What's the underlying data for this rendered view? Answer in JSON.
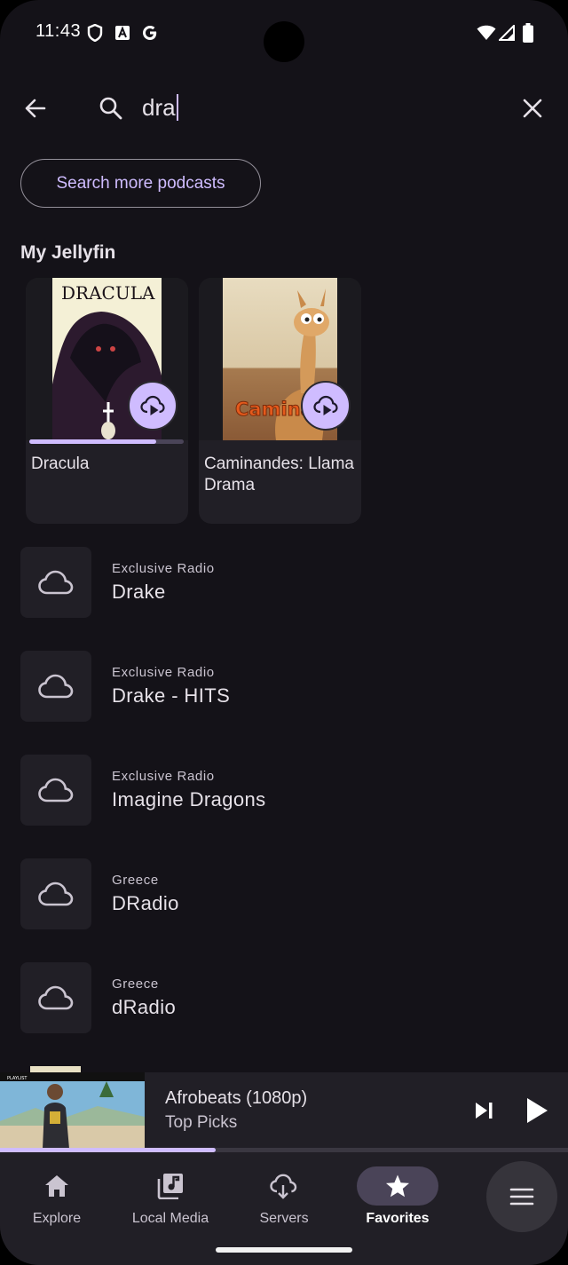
{
  "status_bar": {
    "time": "11:43",
    "left_icons": [
      "shield-icon",
      "a-badge-icon",
      "g-logo-icon"
    ],
    "right_icons": [
      "wifi-icon",
      "signal-icon",
      "battery-icon"
    ]
  },
  "search": {
    "query": "dra",
    "back_icon": "arrow-left-icon",
    "search_icon": "search-icon",
    "clear_icon": "close-icon"
  },
  "chip": {
    "label": "Search more podcasts"
  },
  "section": {
    "title": "My Jellyfin"
  },
  "cards": [
    {
      "title": "Dracula",
      "art_text": "DRACULA",
      "progress": 0.82,
      "icon": "cloud-play-icon"
    },
    {
      "title": "Caminandes: Llama Drama",
      "art_text": "Caminan",
      "icon": "cloud-play-icon"
    }
  ],
  "list": [
    {
      "subtitle": "Exclusive Radio",
      "title": "Drake",
      "icon": "cloud-icon"
    },
    {
      "subtitle": "Exclusive Radio",
      "title": "Drake - HITS",
      "icon": "cloud-icon"
    },
    {
      "subtitle": "Exclusive Radio",
      "title": "Imagine Dragons",
      "icon": "cloud-icon"
    },
    {
      "subtitle": "Greece",
      "title": "DRadio",
      "icon": "cloud-icon"
    },
    {
      "subtitle": "Greece",
      "title": "dRadio",
      "icon": "cloud-icon"
    }
  ],
  "mini_player": {
    "title": "Afrobeats (1080p)",
    "subtitle": "Top Picks",
    "thumb_text": "PLAYLIST",
    "progress": 0.38,
    "icons": [
      "skip-next-icon",
      "play-icon"
    ]
  },
  "nav": {
    "items": [
      {
        "label": "Explore",
        "icon": "home-icon",
        "active": false
      },
      {
        "label": "Local Media",
        "icon": "library-music-icon",
        "active": false
      },
      {
        "label": "Servers",
        "icon": "cloud-sync-icon",
        "active": false
      },
      {
        "label": "Favorites",
        "icon": "star-icon",
        "active": true
      }
    ],
    "menu_icon": "menu-icon"
  },
  "colors": {
    "background": "#141218",
    "surface": "#211f26",
    "accent": "#cfbcff",
    "text": "#e6e1e8",
    "text_secondary": "#cac4d0"
  }
}
